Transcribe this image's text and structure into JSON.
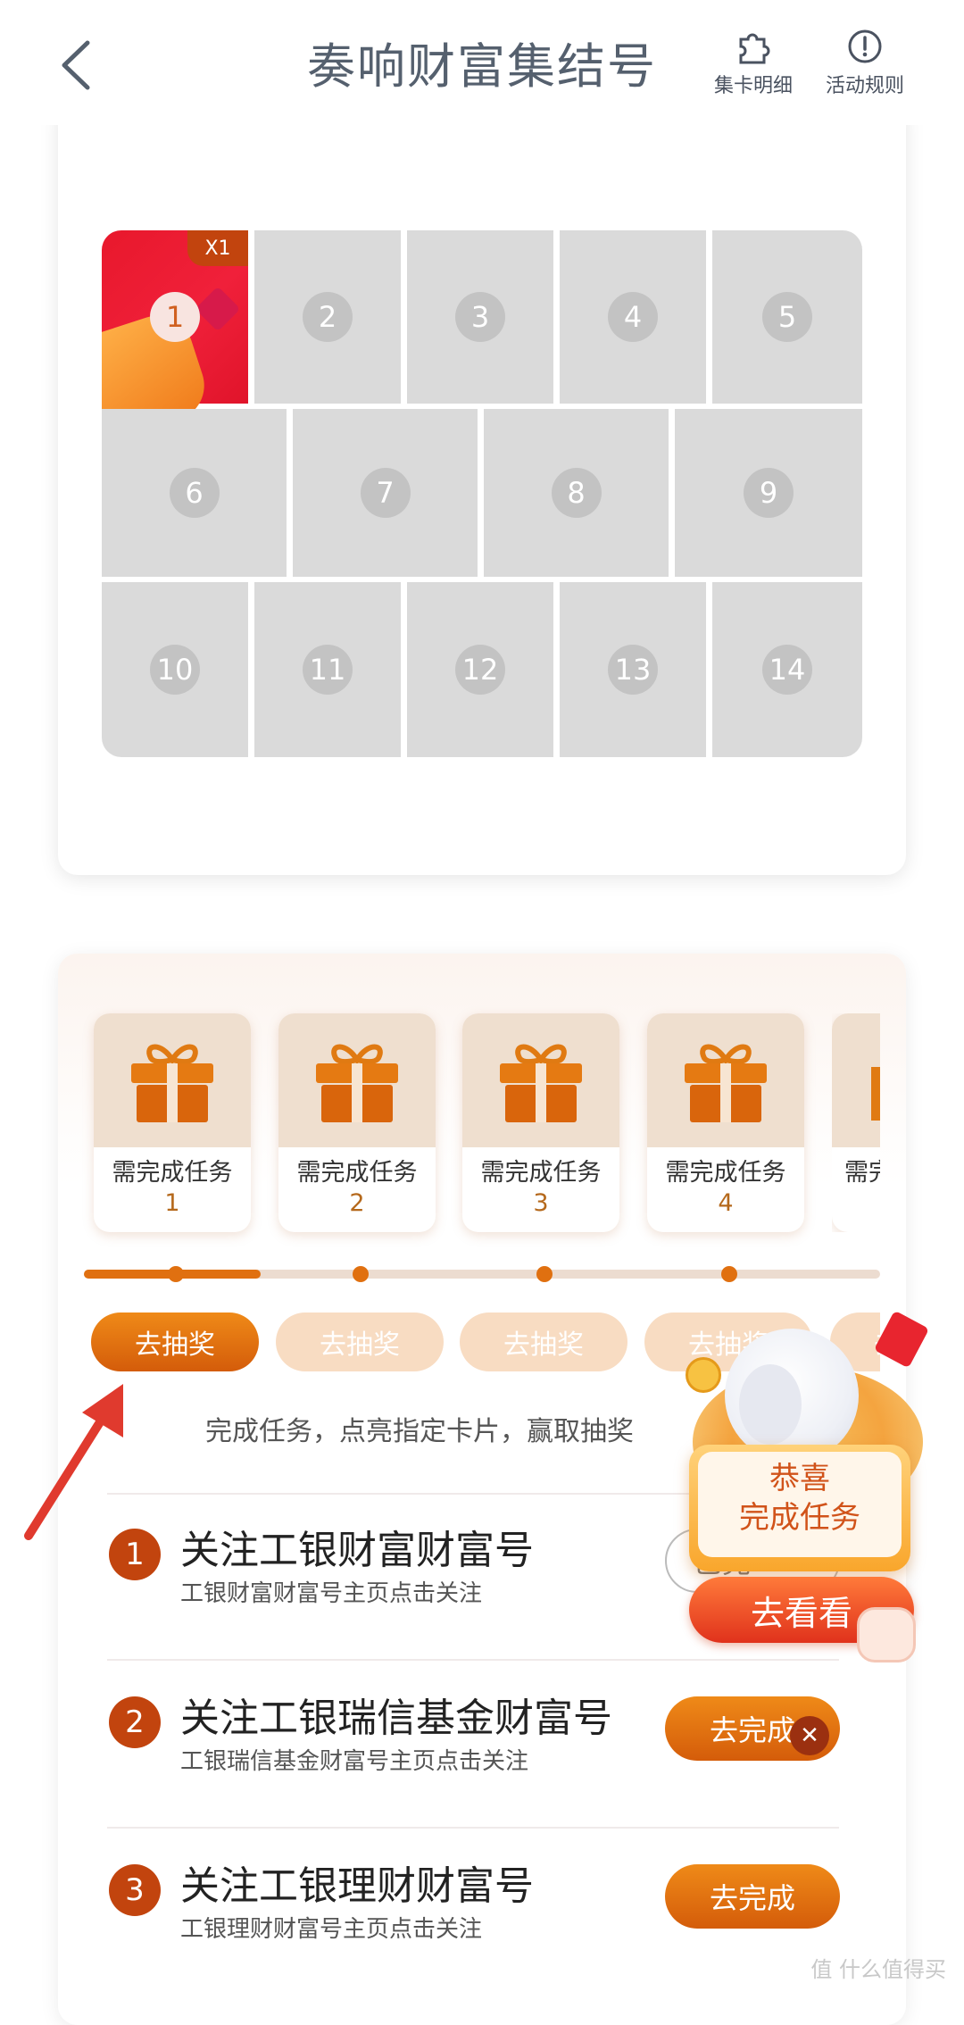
{
  "header": {
    "title": "奏响财富集结号",
    "back_icon": "chevron-left-icon",
    "cards_detail_label": "集卡明细",
    "rules_label": "活动规则"
  },
  "cards": {
    "count_badge": "X1",
    "cells": [
      {
        "num": "1",
        "collected": true
      },
      {
        "num": "2",
        "collected": false
      },
      {
        "num": "3",
        "collected": false
      },
      {
        "num": "4",
        "collected": false
      },
      {
        "num": "5",
        "collected": false
      },
      {
        "num": "6",
        "collected": false
      },
      {
        "num": "7",
        "collected": false
      },
      {
        "num": "8",
        "collected": false
      },
      {
        "num": "9",
        "collected": false
      },
      {
        "num": "10",
        "collected": false
      },
      {
        "num": "11",
        "collected": false
      },
      {
        "num": "12",
        "collected": false
      },
      {
        "num": "13",
        "collected": false
      },
      {
        "num": "14",
        "collected": false
      }
    ]
  },
  "rewards": {
    "need_label": "需完成任务",
    "items": [
      {
        "count": "1"
      },
      {
        "count": "2"
      },
      {
        "count": "3"
      },
      {
        "count": "4"
      }
    ],
    "partial_label": "需完",
    "progress_fraction": 0.22,
    "draw_label": "去抽奖",
    "draw_partial_label": "去抽奖",
    "hint": "完成任务，点亮指定卡片，赢取抽奖"
  },
  "tasks": [
    {
      "num": "1",
      "title": "关注工银财富财富号",
      "sub": "工银财富财富号主页点击关注",
      "button": "已完"
    },
    {
      "num": "2",
      "title": "关注工银瑞信基金财富号",
      "sub": "工银瑞信基金财富号主页点击关注",
      "button": "去完成"
    },
    {
      "num": "3",
      "title": "关注工银理财财富号",
      "sub": "工银理财财富号主页点击关注",
      "button": "去完成"
    }
  ],
  "popup": {
    "congrats_line1": "恭喜",
    "congrats_line2": "完成任务",
    "go_label": "去看看",
    "close_glyph": "✕"
  },
  "watermark": "值 什么值得买",
  "colors": {
    "accent": "#d45c0a",
    "title": "#55606e",
    "card_empty": "#dadada",
    "card_active": "#e8182c"
  }
}
